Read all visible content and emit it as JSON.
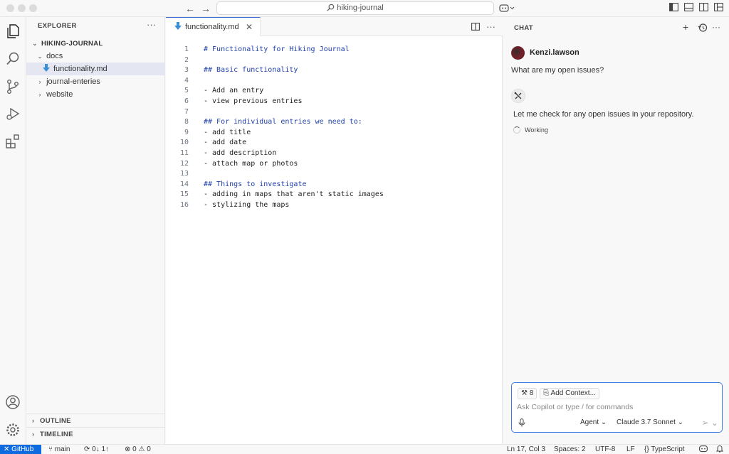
{
  "titlebar": {
    "search_text": "hiking-journal"
  },
  "sidebar": {
    "header": "EXPLORER",
    "more": "···",
    "root": "HIKING-JOURNAL",
    "tree": [
      {
        "label": "docs",
        "expanded": true
      },
      {
        "label": "functionality.md"
      },
      {
        "label": "journal-enteries",
        "expanded": false
      },
      {
        "label": "website",
        "expanded": false
      }
    ],
    "outline": "OUTLINE",
    "timeline": "TIMELINE"
  },
  "editor": {
    "tab_label": "functionality.md",
    "tab_close": "✕",
    "lines": [
      {
        "n": "1",
        "text": "# Functionality for Hiking Journal",
        "hdr": true
      },
      {
        "n": "2",
        "text": ""
      },
      {
        "n": "3",
        "text": "## Basic functionality",
        "hdr": true
      },
      {
        "n": "4",
        "text": ""
      },
      {
        "n": "5",
        "text": "- Add an entry"
      },
      {
        "n": "6",
        "text": "- view previous entries"
      },
      {
        "n": "7",
        "text": ""
      },
      {
        "n": "8",
        "text": "## For individual entries we need to:",
        "hdr": true
      },
      {
        "n": "9",
        "text": "- add title"
      },
      {
        "n": "10",
        "text": "- add date"
      },
      {
        "n": "11",
        "text": "- add description"
      },
      {
        "n": "12",
        "text": "- attach map or photos"
      },
      {
        "n": "13",
        "text": ""
      },
      {
        "n": "14",
        "text": "## Things to investigate",
        "hdr": true
      },
      {
        "n": "15",
        "text": "- adding in maps that aren't static images"
      },
      {
        "n": "16",
        "text": "- stylizing the maps"
      }
    ]
  },
  "chat": {
    "title": "CHAT",
    "user_name": "Kenzi.lawson",
    "user_message": "What are my open issues?",
    "bot_message": "Let me check for any open issues in your repository.",
    "status": "Working",
    "tools_count": "8",
    "add_context": "Add Context...",
    "placeholder": "Ask Copilot or type / for commands",
    "mode": "Agent",
    "model": "Claude 3.7 Sonnet"
  },
  "statusbar": {
    "remote": "GitHub",
    "branch": "main",
    "sync": "0↓ 1↑",
    "problems": "0",
    "warnings": "0",
    "position": "Ln 17, Col 3",
    "spaces": "Spaces: 2",
    "encoding": "UTF-8",
    "eol": "LF",
    "language": "TypeScript"
  },
  "colors": {
    "accent": "#0d6adf",
    "header_text": "#1f3fa8",
    "markdown_icon": "#3b8fd6"
  }
}
